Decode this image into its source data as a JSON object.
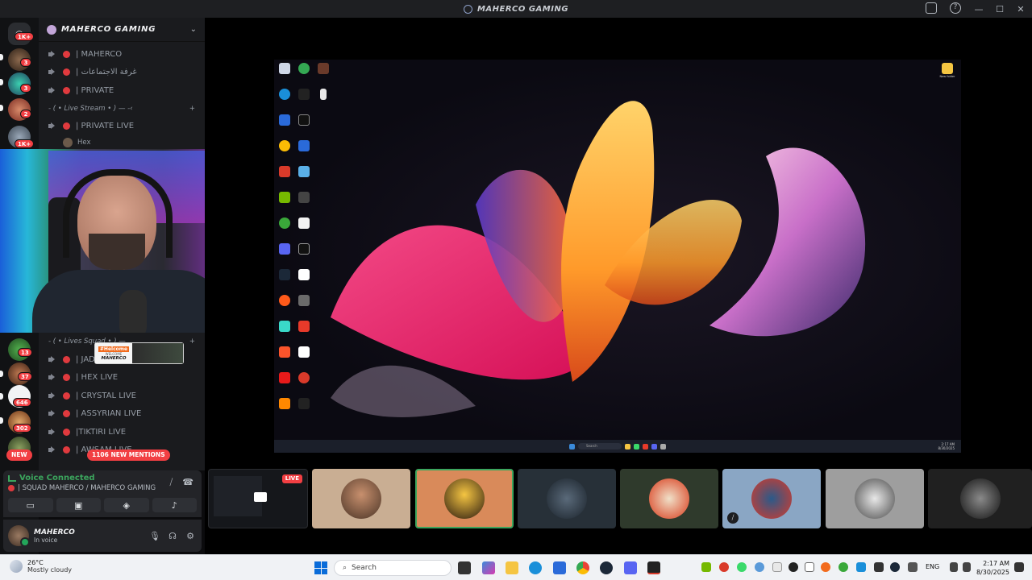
{
  "window": {
    "title": "MAHERCO GAMING"
  },
  "server": {
    "name": "MAHERCO GAMING"
  },
  "rail_badges": [
    "1K+",
    "3",
    "3",
    "2",
    "1K+",
    "13",
    "37",
    "646",
    "302"
  ],
  "channels_top": [
    {
      "name": "| MAHERCO"
    },
    {
      "name": "| غرفة الاجتماعات"
    },
    {
      "name": "| PRIVATE"
    }
  ],
  "category_live_stream": "- ( • Live Stream • ) — -‹",
  "channel_private_live": "| PRIVATE LIVE",
  "member_hex": "Hex",
  "category_lives": "- ( • Lives Squad • ) —",
  "channels_bottom": [
    {
      "name": "| JAD"
    },
    {
      "name": "| HEX LIVE"
    },
    {
      "name": "| CRYSTAL LIVE"
    },
    {
      "name": "| ASSYRIAN LIVE"
    },
    {
      "name": "|TIKTIRI LIVE"
    },
    {
      "name": "| AWSAM LIVE"
    }
  ],
  "alert": {
    "brand": "#Helcome",
    "sub": "WELCOME",
    "user": "MAHERCO"
  },
  "new_badge": "NEW",
  "mentions_badge": "1106 NEW MENTIONS",
  "voice": {
    "status": "Voice Connected",
    "channel": "| SQUAD MAHERCO / MAHERCO GAMING"
  },
  "user": {
    "name": "MAHERCO",
    "status": "In voice"
  },
  "stream_live_label": "LIVE",
  "desktop": {
    "new_folder": "New folder",
    "search": "Search",
    "clock_time": "2:17 AM",
    "clock_date": "8/30/2025"
  },
  "taskbar": {
    "temp": "26°C",
    "weather": "Mostly cloudy",
    "search_placeholder": "Search",
    "lang": "ENG",
    "time": "2:17 AM",
    "date": "8/30/2025"
  },
  "colors": {
    "accent_red": "#f23f43",
    "voice_green": "#3ba55d",
    "rail_bg": "#111214"
  }
}
